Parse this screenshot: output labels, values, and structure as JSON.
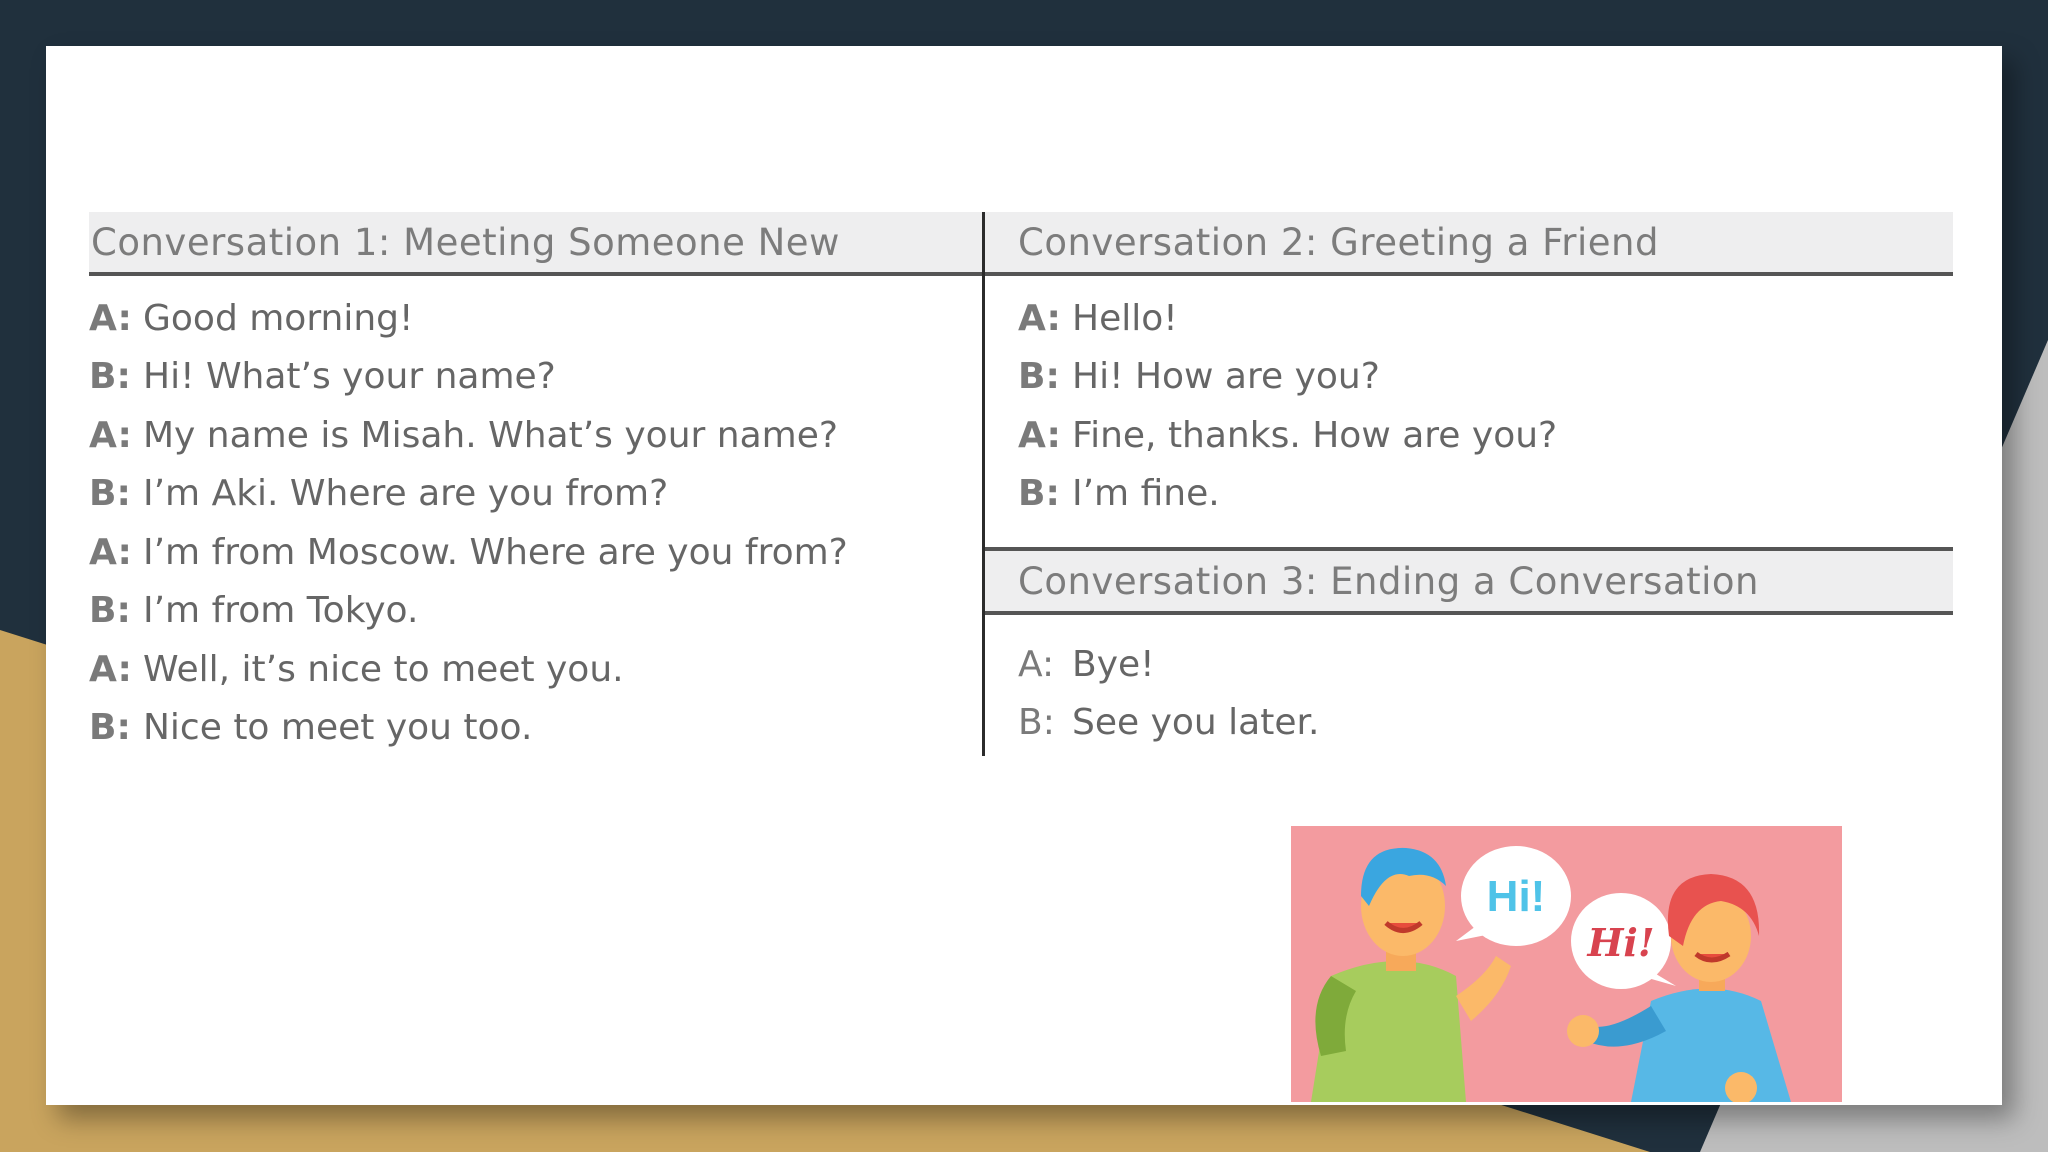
{
  "conversation1": {
    "title": "Conversation 1: Meeting Someone New",
    "lines": [
      {
        "speaker": "A:",
        "text": "Good morning!"
      },
      {
        "speaker": "B:",
        "text": "Hi! What’s your name?"
      },
      {
        "speaker": "A:",
        "text": "My name is Misah. What’s your name?"
      },
      {
        "speaker": "B:",
        "text": "I’m Aki. Where are you from?"
      },
      {
        "speaker": "A:",
        "text": "I’m from Moscow. Where are you from?"
      },
      {
        "speaker": "B:",
        "text": "I’m from Tokyo."
      },
      {
        "speaker": "A:",
        "text": "Well, it’s nice to meet you."
      },
      {
        "speaker": "B:",
        "text": "Nice to meet you too."
      }
    ]
  },
  "conversation2": {
    "title": "Conversation 2: Greeting a Friend",
    "lines": [
      {
        "speaker": "A:",
        "text": "Hello!"
      },
      {
        "speaker": "B:",
        "text": "Hi! How are you?"
      },
      {
        "speaker": "A:",
        "text": "Fine, thanks. How are you?"
      },
      {
        "speaker": "B:",
        "text": "I’m fine."
      }
    ]
  },
  "conversation3": {
    "title": "Conversation 3: Ending a Conversation",
    "lines": [
      {
        "speaker": "A:",
        "text": "Bye!"
      },
      {
        "speaker": "B:",
        "text": "See you later."
      }
    ]
  },
  "illustration": {
    "bubble_left": "Hi!",
    "bubble_right": "Hi!",
    "background_color": "#f39b9f"
  },
  "colors": {
    "frame_dark": "#20303d",
    "frame_gold": "#c9a45e",
    "header_bg": "#eeeeef",
    "text": "#666666"
  }
}
